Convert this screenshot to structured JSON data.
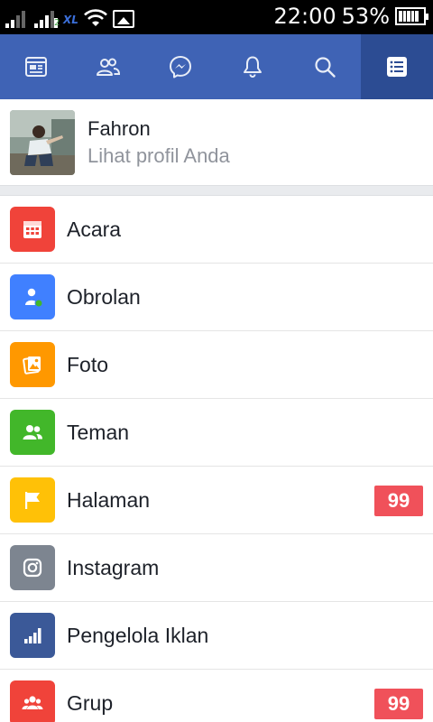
{
  "status_bar": {
    "carrier": "XL",
    "sim_slot": "2",
    "time": "22:00",
    "battery_percent": "53%",
    "battery_level": 0.53,
    "icons": [
      "signal-1-icon",
      "signal-2-icon",
      "carrier-logo-icon",
      "wifi-icon",
      "image-notification-icon",
      "battery-icon"
    ]
  },
  "nav": {
    "tabs": [
      {
        "name": "news-feed",
        "icon": "news-feed-icon",
        "active": false
      },
      {
        "name": "friend-requests",
        "icon": "friends-icon",
        "active": false
      },
      {
        "name": "messenger",
        "icon": "messenger-icon",
        "active": false
      },
      {
        "name": "notifications",
        "icon": "bell-icon",
        "active": false
      },
      {
        "name": "search",
        "icon": "search-icon",
        "active": false
      },
      {
        "name": "menu",
        "icon": "menu-list-icon",
        "active": true
      }
    ],
    "background": "#3f63b5",
    "active_background": "#2c4c93"
  },
  "profile": {
    "name": "Fahron",
    "subtitle": "Lihat profil Anda"
  },
  "menu": {
    "items": [
      {
        "label": "Acara",
        "icon": "calendar-icon",
        "color": "#f0433a",
        "badge": null
      },
      {
        "label": "Obrolan",
        "icon": "chat-person-icon",
        "color": "#4080ff",
        "badge": null
      },
      {
        "label": "Foto",
        "icon": "photos-icon",
        "color": "#ff9800",
        "badge": null
      },
      {
        "label": "Teman",
        "icon": "friends-icon",
        "color": "#42b72a",
        "badge": null
      },
      {
        "label": "Halaman",
        "icon": "flag-icon",
        "color": "#ffc107",
        "badge": "99"
      },
      {
        "label": "Instagram",
        "icon": "instagram-icon",
        "color": "#7d8590",
        "badge": null
      },
      {
        "label": "Pengelola Iklan",
        "icon": "ads-chart-icon",
        "color": "#3b5998",
        "badge": null
      },
      {
        "label": "Grup",
        "icon": "groups-icon",
        "color": "#f0433a",
        "badge": "99"
      }
    ]
  },
  "badge_color": "#f0515a"
}
